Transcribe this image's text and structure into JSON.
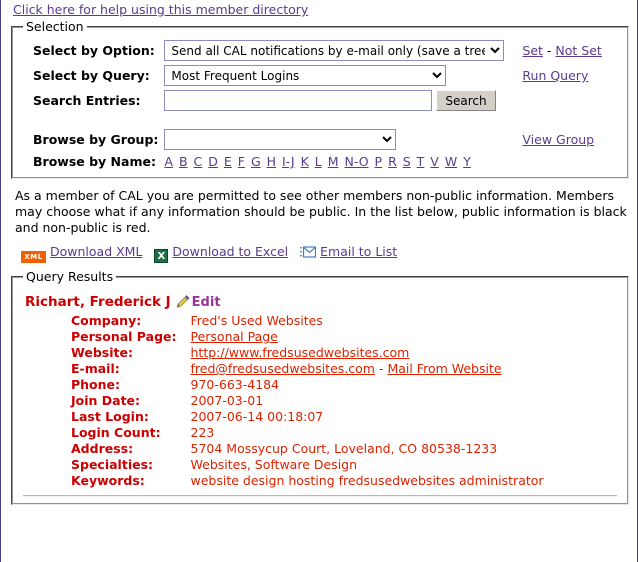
{
  "help_link": "Click here for help using this member directory",
  "selection": {
    "legend": "Selection",
    "option_label": "Select by Option:",
    "option_value": "Send all CAL notifications by e-mail only (save a tree)",
    "set_link": "Set",
    "set_separator": "-",
    "not_set_link": "Not Set",
    "query_label": "Select by Query:",
    "query_value": "Most Frequent Logins",
    "run_query_link": "Run Query",
    "search_label": "Search Entries:",
    "search_value": "",
    "search_placeholder": "",
    "search_button": "Search",
    "group_label": "Browse by Group:",
    "group_value": "",
    "view_group_link": "View Group",
    "name_label": "Browse by Name:",
    "alphabet": [
      "A",
      "B",
      "C",
      "D",
      "E",
      "F",
      "G",
      "H",
      "I-J",
      "K",
      "L",
      "M",
      "N-O",
      "P",
      "R",
      "S",
      "T",
      "V",
      "W",
      "Y"
    ]
  },
  "notice": "As a member of CAL you are permitted to see other members non-public information.  Members may choose what if any information should be public.  In the list below, public information is black and non-public is red.",
  "downloads": {
    "xml_icon": "xml-icon",
    "xml_label": "Download XML",
    "excel_icon": "excel-icon",
    "excel_label": "Download to Excel",
    "email_icon": "email-icon",
    "email_label": "Email to List"
  },
  "results": {
    "legend": "Query Results",
    "member_name": "Richart, Frederick J",
    "edit_icon": "pencil-icon",
    "edit_label": "Edit",
    "fields": [
      {
        "key": "Company:",
        "value": "Fred's Used Websites",
        "link": false
      },
      {
        "key": "Personal Page:",
        "value": "Personal Page",
        "link": true
      },
      {
        "key": "Website:",
        "value": "http://www.fredsusedwebsites.com",
        "link": true
      },
      {
        "key": "E-mail:",
        "value": "fred@fredsusedwebsites.com",
        "link": true,
        "separator": " - ",
        "extra_value": "Mail From Website",
        "extra_link": true
      },
      {
        "key": "Phone:",
        "value": "970-663-4184",
        "link": false
      },
      {
        "key": "Join Date:",
        "value": "2007-03-01",
        "link": false
      },
      {
        "key": "Last Login:",
        "value": "2007-06-14 00:18:07",
        "link": false
      },
      {
        "key": "Login Count:",
        "value": "223",
        "link": false
      },
      {
        "key": "Address:",
        "value": "5704 Mossycup Court, Loveland, CO 80538-1233",
        "link": false
      },
      {
        "key": "Specialties:",
        "value": "Websites, Software Design",
        "link": false
      },
      {
        "key": "Keywords:",
        "value": "website design hosting fredsusedwebsites administrator",
        "link": false
      }
    ]
  },
  "colors": {
    "link": "#5a3a8e",
    "non_public_red": "#cc0000",
    "value_red": "#dd2200",
    "edit_purple": "#993399",
    "page_border": "#4b3f8c",
    "xml_orange": "#f06000",
    "excel_green": "#1d7044"
  }
}
